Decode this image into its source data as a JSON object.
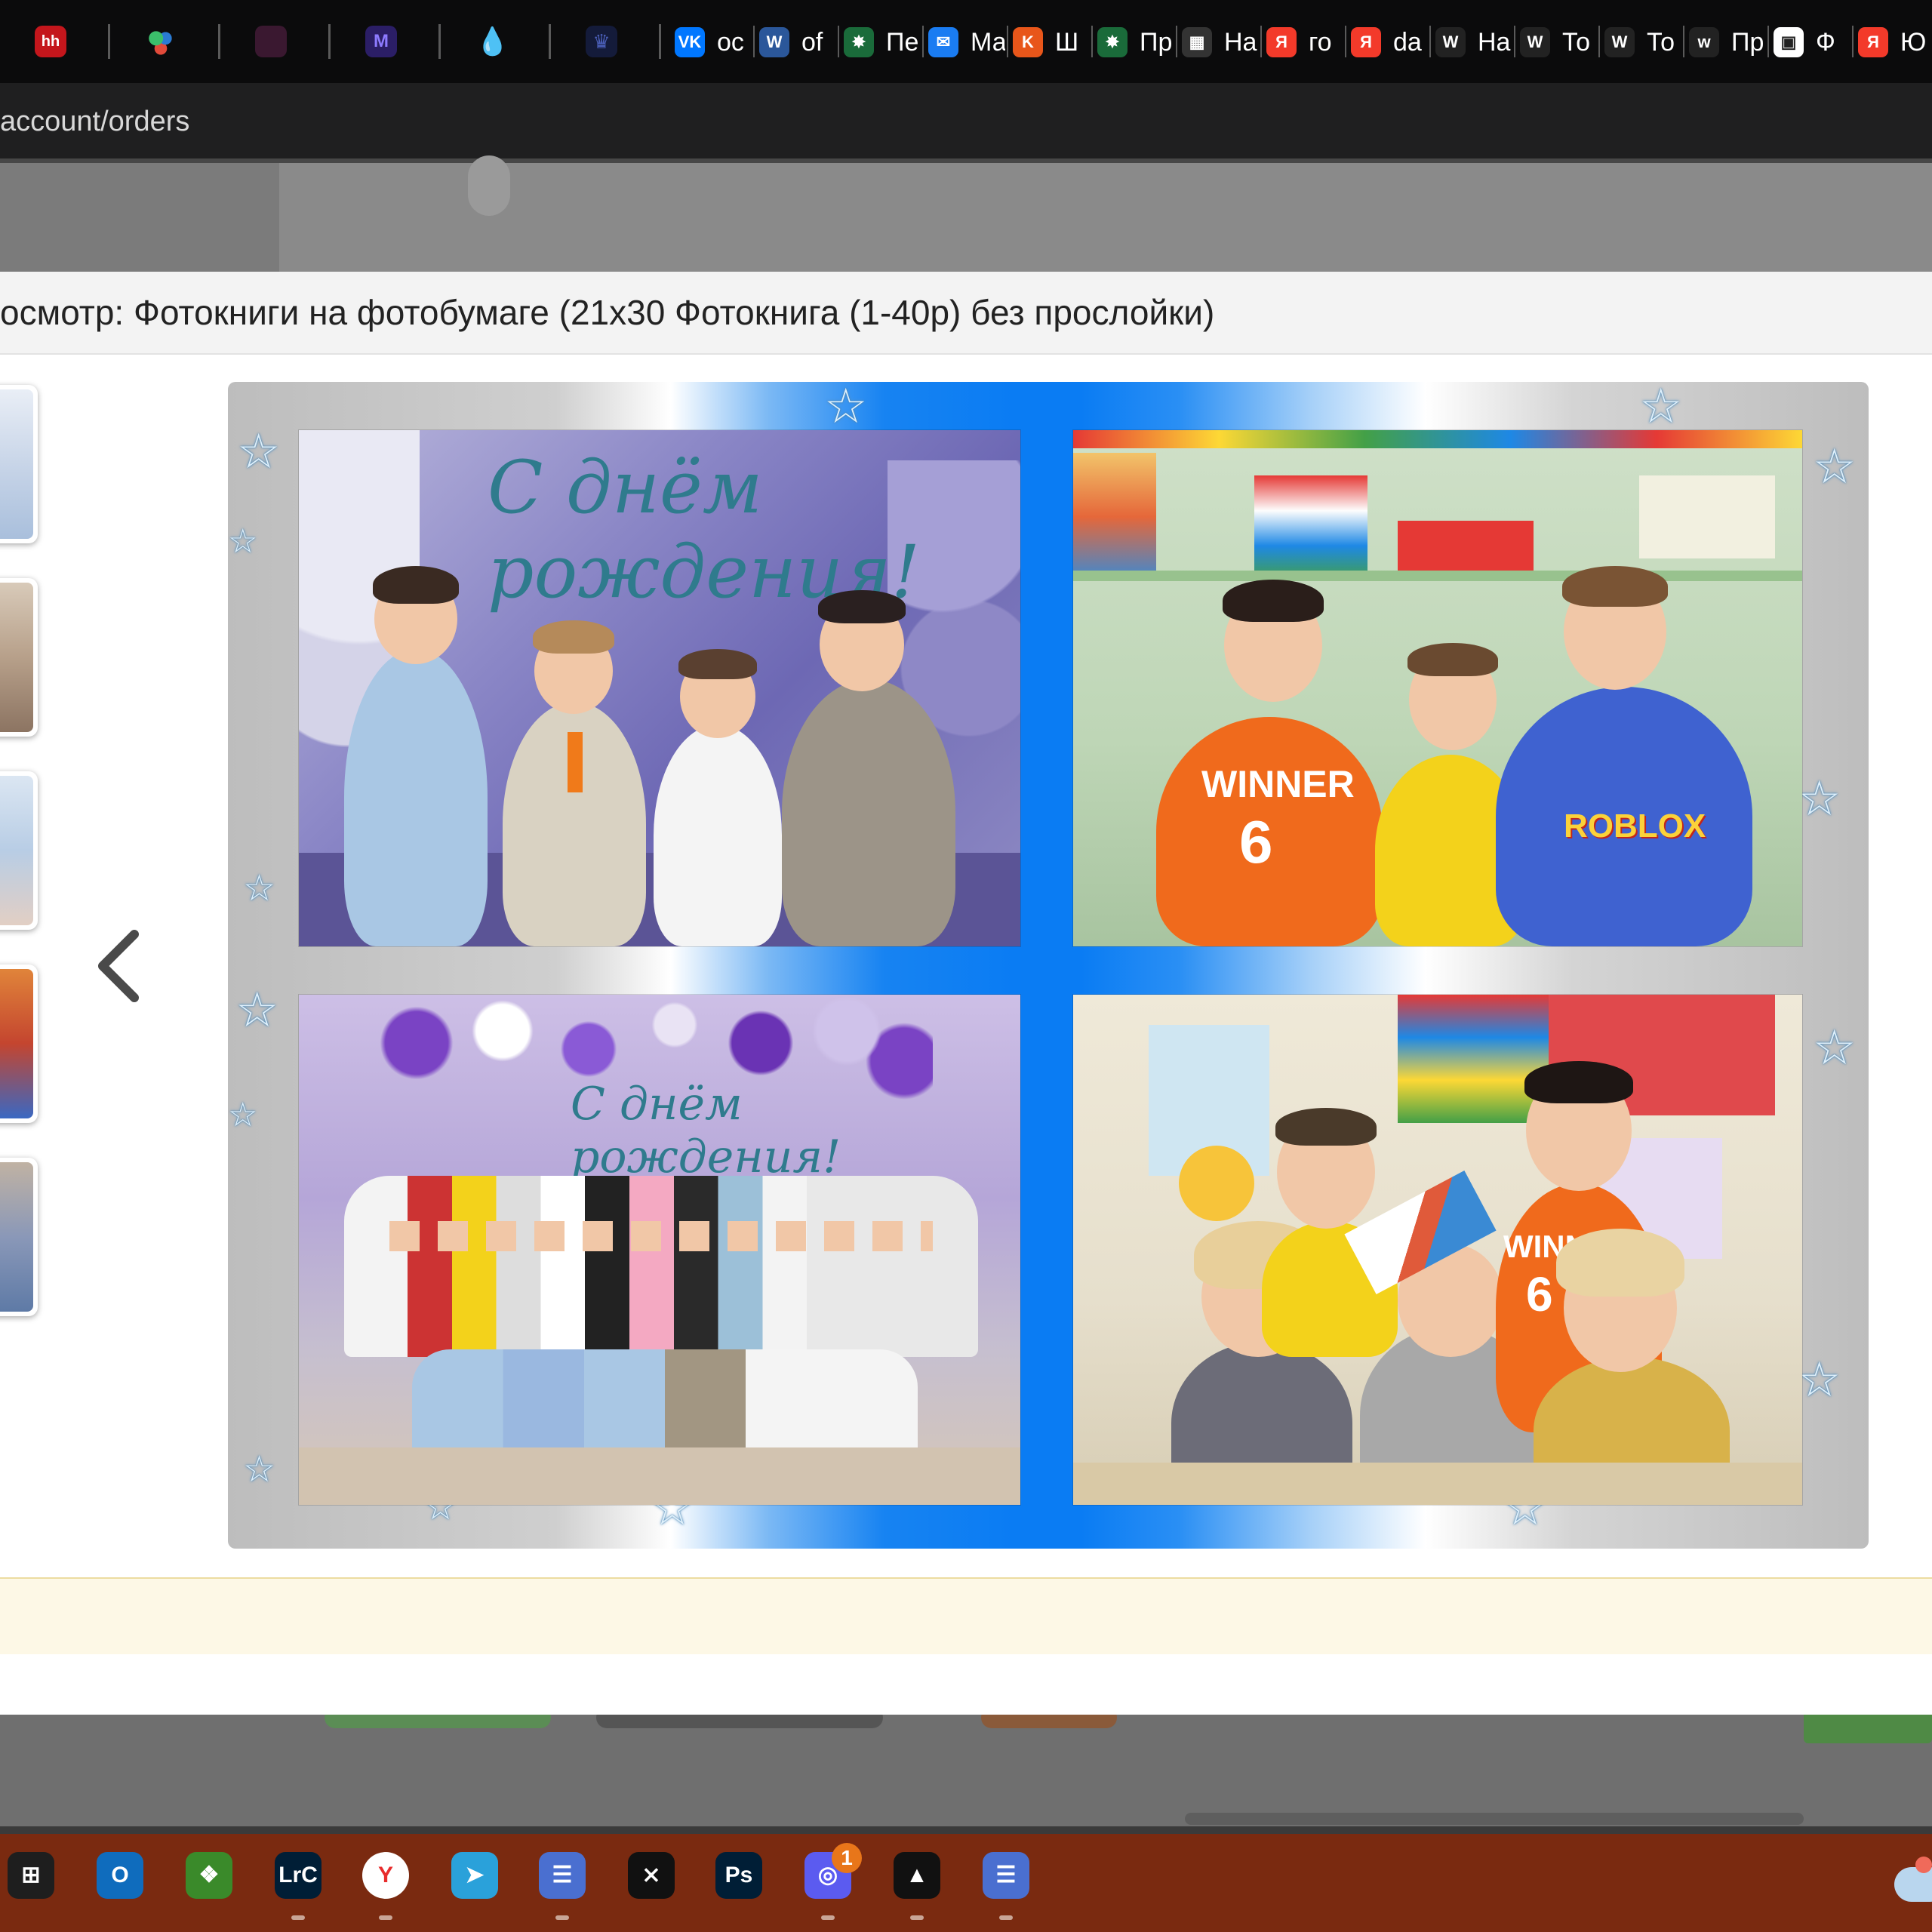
{
  "browser": {
    "url": "account/orders",
    "pinned_tabs": [
      {
        "icon": "hh-icon",
        "color": "#c4161c",
        "label": "hh"
      },
      {
        "icon": "dots-app-icon",
        "color": "#2e8b57",
        "label": ""
      },
      {
        "icon": "video-app-icon",
        "color": "#5a2a8a",
        "label": ""
      },
      {
        "icon": "m-app-icon",
        "color": "#3b2a8a",
        "label": "M"
      },
      {
        "icon": "drop-app-icon",
        "color": "#18324a",
        "label": ""
      },
      {
        "icon": "crown-app-icon",
        "color": "#1a2350",
        "label": ""
      }
    ],
    "tabs": [
      {
        "icon": "vk-icon",
        "color": "#0077ff",
        "glyph": "VK",
        "title": "oc"
      },
      {
        "icon": "word-icon",
        "color": "#2b579a",
        "glyph": "W",
        "title": "of"
      },
      {
        "icon": "pin-icon",
        "color": "#1a6b3a",
        "glyph": "✸",
        "title": "Пе"
      },
      {
        "icon": "chat-icon",
        "color": "#1a7cf2",
        "glyph": "✉",
        "title": "Ма"
      },
      {
        "icon": "k-icon",
        "color": "#e8561a",
        "glyph": "K",
        "title": "Ш"
      },
      {
        "icon": "pin-icon",
        "color": "#1a6b3a",
        "glyph": "✸",
        "title": "Пр"
      },
      {
        "icon": "calendar-icon",
        "color": "#333333",
        "glyph": "▦",
        "title": "На"
      },
      {
        "icon": "yandex-icon",
        "color": "#f33a2a",
        "glyph": "Я",
        "title": "го"
      },
      {
        "icon": "yandex-icon",
        "color": "#f33a2a",
        "glyph": "Я",
        "title": "da"
      },
      {
        "icon": "w-icon",
        "color": "#222222",
        "glyph": "W",
        "title": "На"
      },
      {
        "icon": "w-icon",
        "color": "#222222",
        "glyph": "W",
        "title": "То"
      },
      {
        "icon": "w-icon",
        "color": "#222222",
        "glyph": "W",
        "title": "То"
      },
      {
        "icon": "w-icon",
        "color": "#222222",
        "glyph": "w",
        "title": "Пр"
      },
      {
        "icon": "grid-icon",
        "color": "#ffffff",
        "glyph": "▣",
        "title": "Ф"
      },
      {
        "icon": "yandex-icon",
        "color": "#f33a2a",
        "glyph": "Я",
        "title": "Ю"
      }
    ]
  },
  "modal": {
    "title": "осмотр: Фотокниги на фотобумаге (21x30 Фотокнига (1-40р) без прослойки)",
    "prev_icon": "chevron-left-icon",
    "thumbnails": [
      {
        "name": "thumbnail-1",
        "color": "#d9e2ef"
      },
      {
        "name": "thumbnail-2",
        "color": "#c9b8a6"
      },
      {
        "name": "thumbnail-3",
        "color": "#c7d8ea"
      },
      {
        "name": "thumbnail-4",
        "color": "#d88a4a"
      },
      {
        "name": "thumbnail-5",
        "color": "#b6a99a"
      }
    ],
    "photos": [
      {
        "name": "photo-birthday-boys",
        "caption": "С днём рождения!"
      },
      {
        "name": "photo-boys-shelves",
        "shirt_text": "WINNER",
        "shirt_number": "6",
        "shirt_text_2": "ROBLOX"
      },
      {
        "name": "photo-group",
        "caption": "С днём рождения!"
      },
      {
        "name": "photo-kids-book",
        "shirt_text": "WINNER",
        "shirt_number": "6"
      }
    ]
  },
  "taskbar": {
    "apps": [
      {
        "name": "start-icon",
        "color": "#1e1e1e",
        "glyph": "⊞"
      },
      {
        "name": "outlook-icon",
        "color": "#0f6cbd",
        "glyph": "O"
      },
      {
        "name": "puzzle-icon",
        "color": "#3a8a2a",
        "glyph": "❖"
      },
      {
        "name": "lightroom-icon",
        "color": "#001e36",
        "glyph": "LrC"
      },
      {
        "name": "yandex-browser-icon",
        "color": "#ffffff",
        "glyph": "Y"
      },
      {
        "name": "telegram-icon",
        "color": "#2aa1da",
        "glyph": "➤"
      },
      {
        "name": "teams-icon",
        "color": "#4a6fd0",
        "glyph": "☰"
      },
      {
        "name": "capcut-icon",
        "color": "#111111",
        "glyph": "⨯"
      },
      {
        "name": "photoshop-icon",
        "color": "#001e36",
        "glyph": "Ps"
      },
      {
        "name": "messenger-icon",
        "color": "#5b5bf0",
        "glyph": "◎"
      },
      {
        "name": "ghost-icon",
        "color": "#111111",
        "glyph": "▲"
      },
      {
        "name": "teams-icon-2",
        "color": "#4a6fd0",
        "glyph": "☰"
      }
    ],
    "badge_count": "1"
  }
}
